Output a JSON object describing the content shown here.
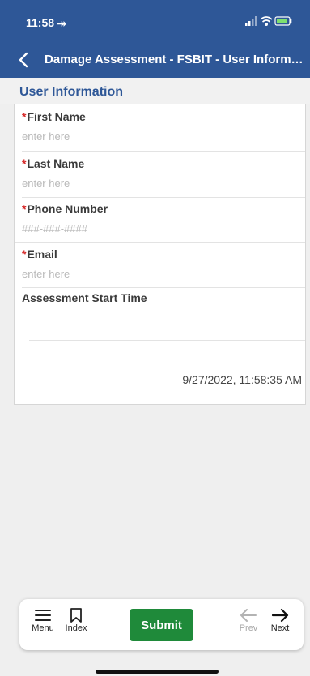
{
  "status_bar": {
    "time": "11:58 ⯮"
  },
  "nav": {
    "title": "Damage Assessment - FSBIT - User Information"
  },
  "section": {
    "title": "User Information"
  },
  "required_marker": "*",
  "fields": [
    {
      "label": "First Name",
      "placeholder": "enter here",
      "value": ""
    },
    {
      "label": "Last Name",
      "placeholder": "enter here",
      "value": ""
    },
    {
      "label": "Phone Number",
      "placeholder": "###-###-####",
      "value": ""
    },
    {
      "label": "Email",
      "placeholder": "enter here",
      "value": ""
    }
  ],
  "start_time": {
    "label": "Assessment Start Time",
    "value": "9/27/2022, 11:58:35 AM"
  },
  "toolbar": {
    "menu_label": "Menu",
    "index_label": "Index",
    "submit_label": "Submit",
    "prev_label": "Prev",
    "next_label": "Next"
  },
  "colors": {
    "header": "#2e5797",
    "submit": "#1f8a3a",
    "required": "#d52828"
  },
  "icons": [
    "back-chevron-icon",
    "menu-icon",
    "bookmark-icon",
    "arrow-left-icon",
    "arrow-right-icon",
    "signal-icon",
    "wifi-icon",
    "battery-icon"
  ]
}
